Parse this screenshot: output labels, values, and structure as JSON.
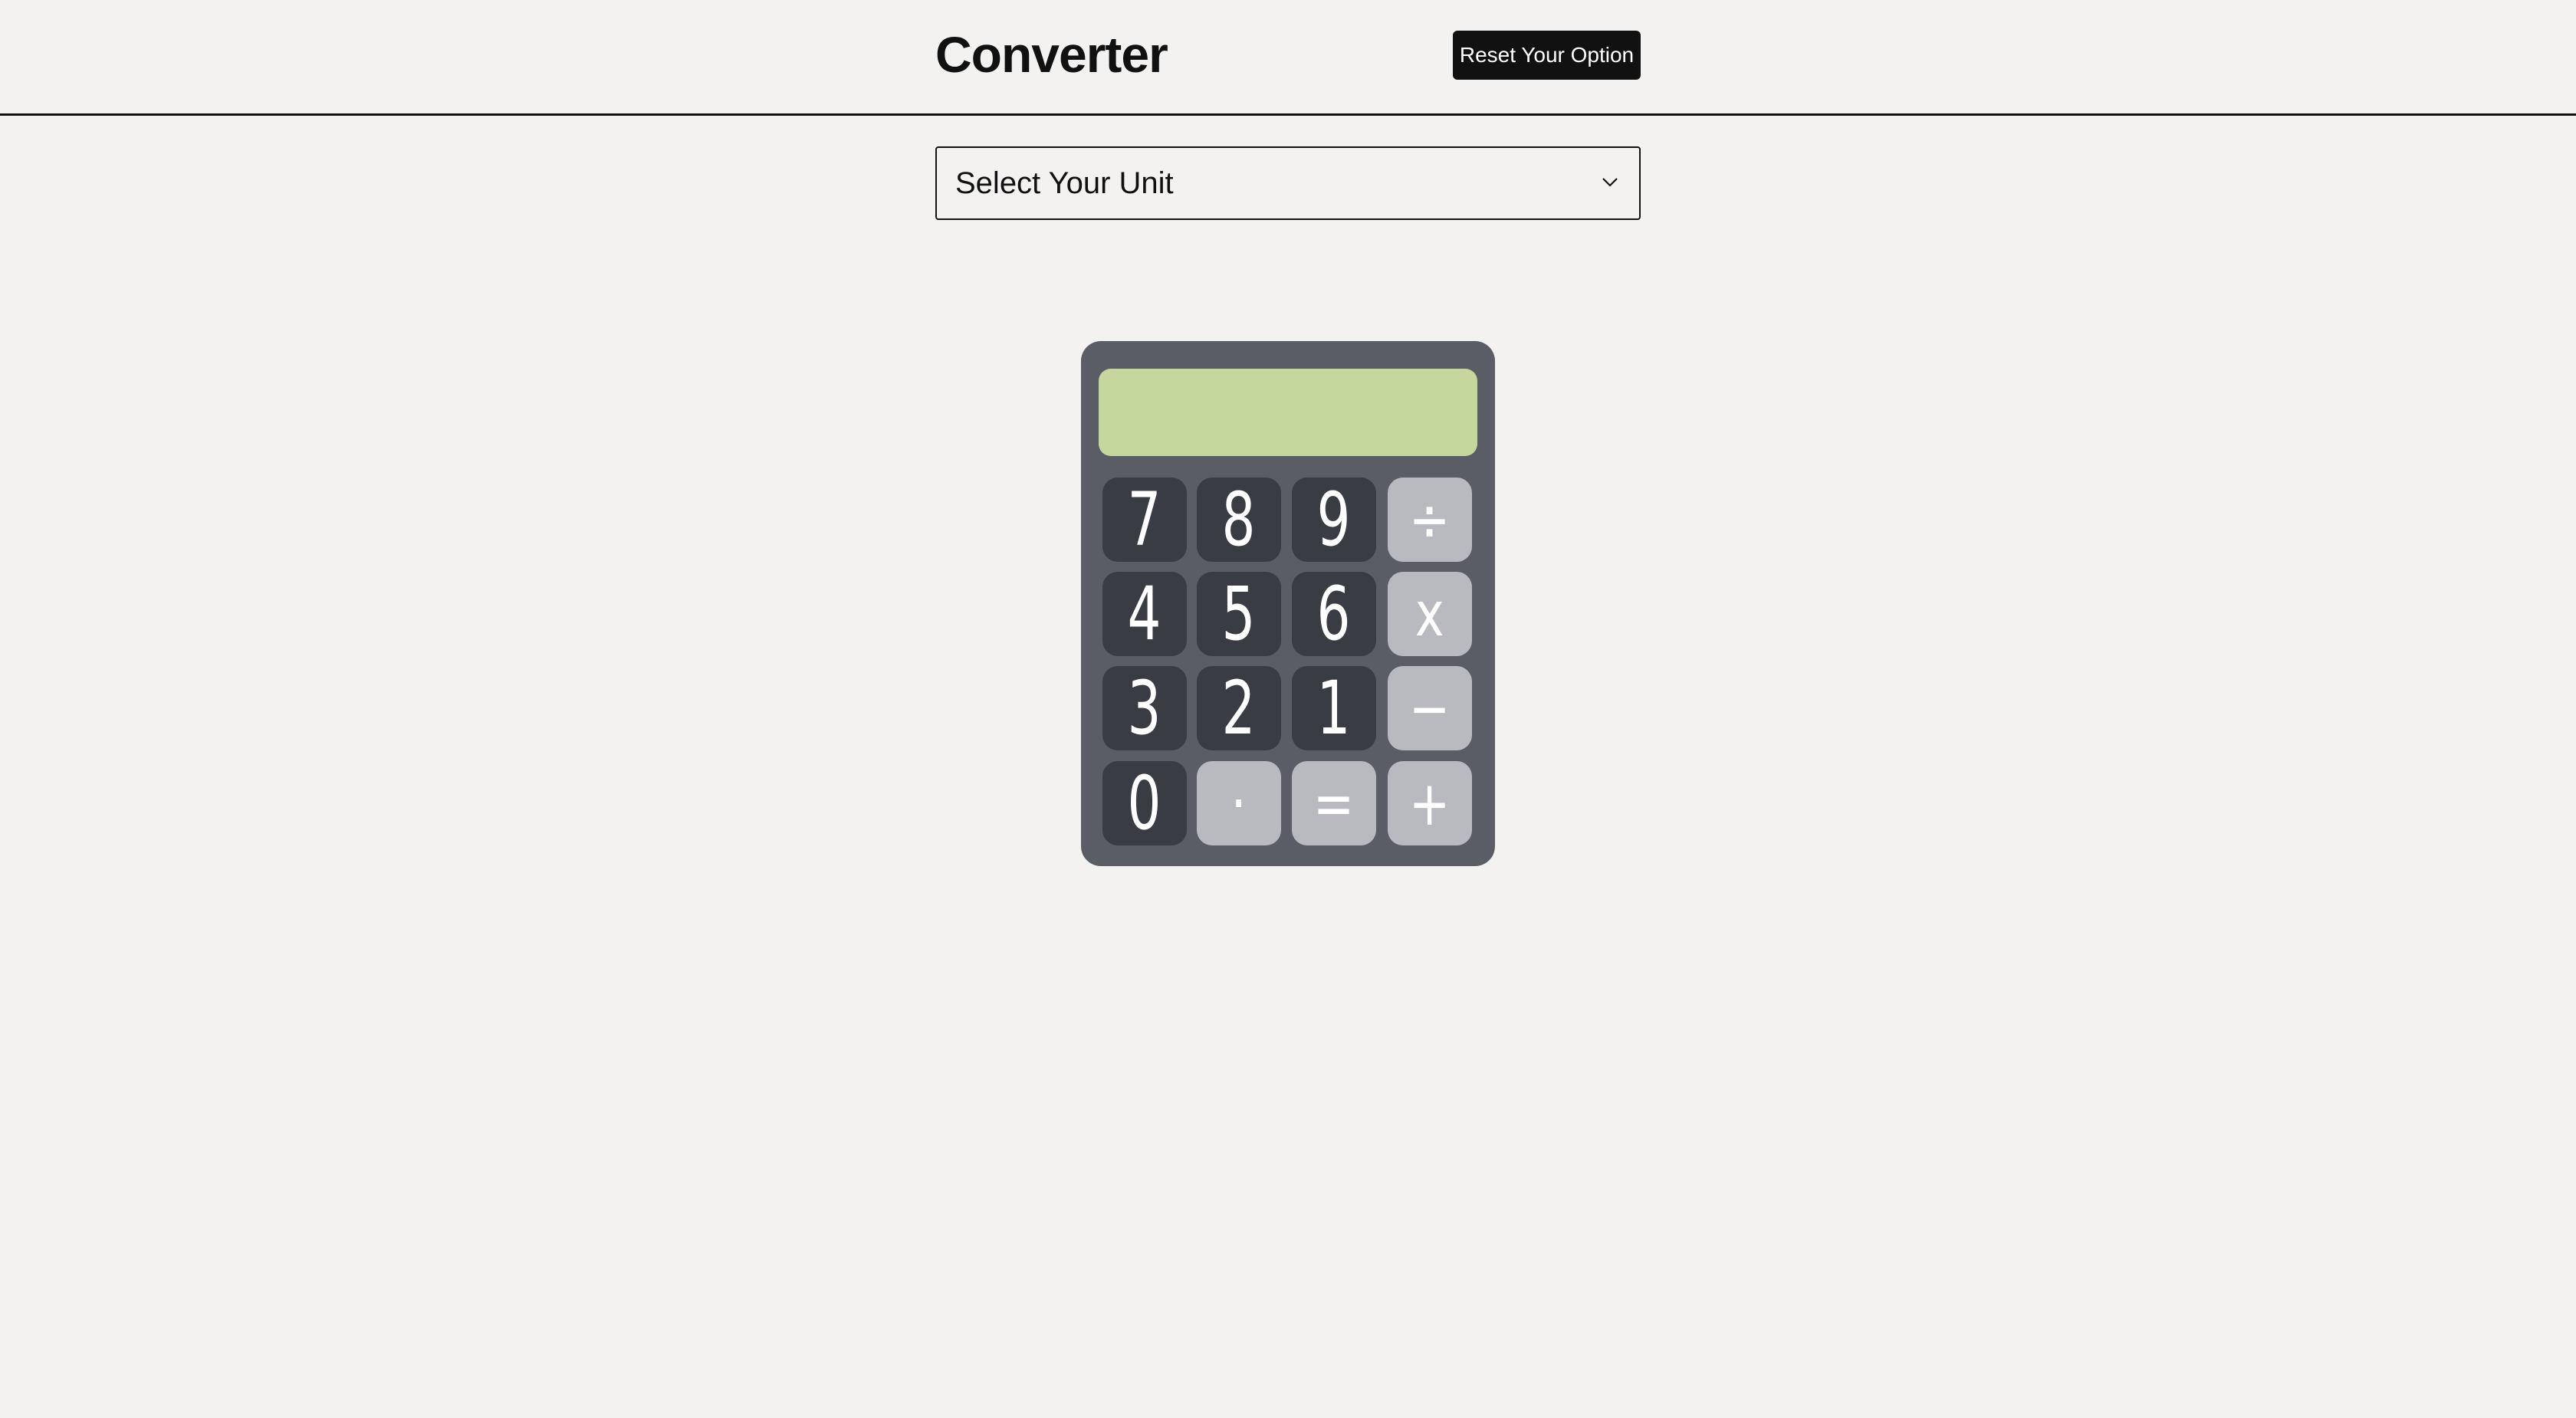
{
  "app": {
    "title": "Converter"
  },
  "header": {
    "reset_label": "Reset Your Option"
  },
  "unit_select": {
    "selected": "Select Your Unit",
    "icon": "chevron-down-icon"
  },
  "calculator": {
    "display_value": "",
    "display_color": "#c5d79d",
    "body_color": "#5b5d66",
    "digit_key_color": "#3a3c44",
    "operator_key_color": "#b9babf",
    "keys": {
      "seven": "7",
      "eight": "8",
      "nine": "9",
      "divide": "÷",
      "four": "4",
      "five": "5",
      "six": "6",
      "multiply": "x",
      "three": "3",
      "two": "2",
      "one": "1",
      "subtract": "−",
      "zero": "0",
      "decimal": "·",
      "equals": "=",
      "add": "+"
    }
  }
}
